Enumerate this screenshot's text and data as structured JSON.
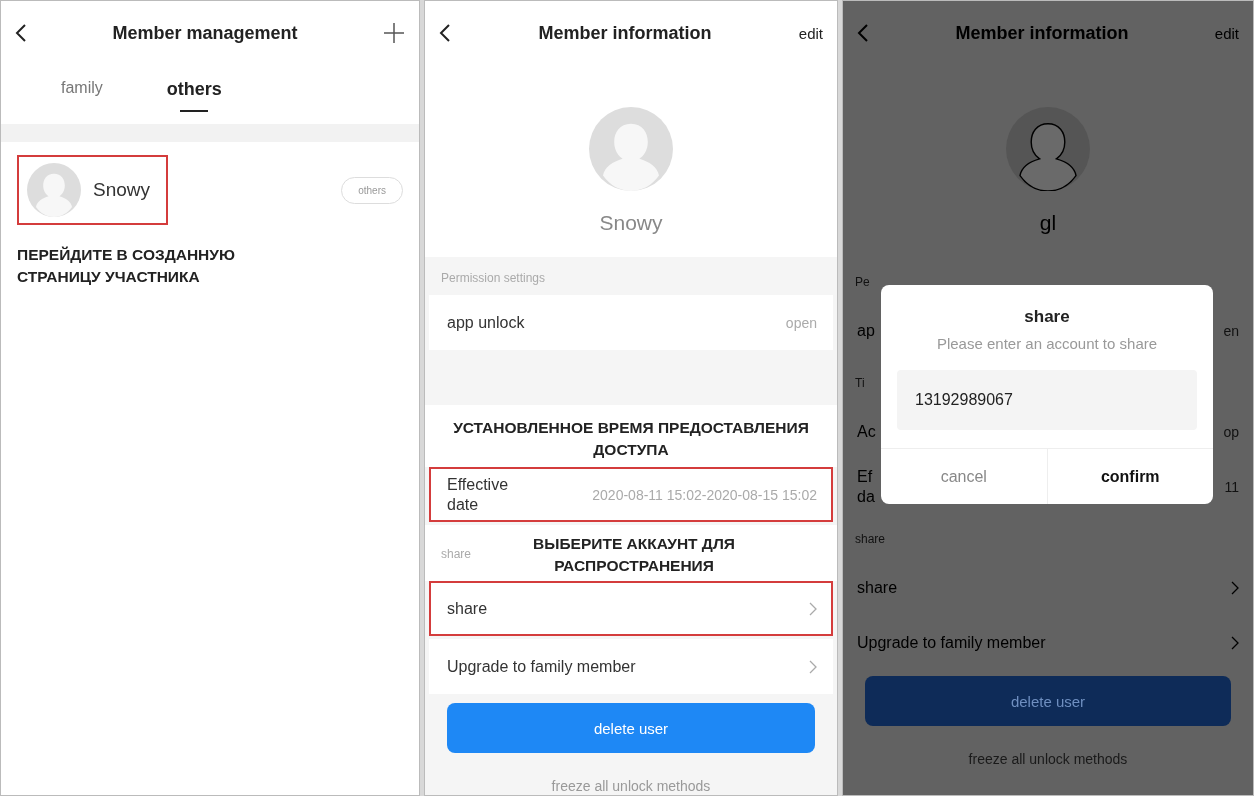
{
  "panels": [
    {
      "kind": "member_list",
      "title": "Member management",
      "dimmed": false,
      "tabs": [
        {
          "label": "family",
          "selected": false
        },
        {
          "label": "others",
          "selected": true
        }
      ],
      "members": [
        {
          "name": "Snowy",
          "tag": "others",
          "highlighted": true
        }
      ],
      "caption": "ПЕРЕЙДИТЕ В СОЗДАННУЮ СТРАНИЦУ УЧАСТНИКА"
    },
    {
      "kind": "member_info",
      "title": "Member information",
      "action": "edit",
      "name": "Snowy",
      "dimmed": false,
      "items": [
        {
          "kind": "label",
          "text": "Permission settings"
        },
        {
          "kind": "row",
          "label": "app unlock",
          "value": "open",
          "chevron": false,
          "highlighted": false
        },
        {
          "kind": "caption",
          "text": "УСТАНОВЛЕННОЕ ВРЕМЯ ПРЕДОСТАВЛЕНИЯ ДОСТУПА"
        },
        {
          "kind": "row",
          "label": "Effective date",
          "value": "2020-08-11 15:02-2020-08-15 15:02",
          "chevron": false,
          "highlighted": true
        },
        {
          "kind": "caption",
          "text": "ВЫБЕРИТЕ АККАУНТ ДЛЯ РАСПРОСТРАНЕНИЯ",
          "aside": "share"
        },
        {
          "kind": "row",
          "label": "share",
          "chevron": true,
          "highlighted": true
        },
        {
          "kind": "row",
          "label": "Upgrade to family member",
          "chevron": true,
          "highlighted": false
        },
        {
          "kind": "button",
          "label": "delete user"
        },
        {
          "kind": "link",
          "label": "freeze all unlock methods"
        }
      ]
    },
    {
      "kind": "member_info",
      "title": "Member information",
      "action": "edit",
      "name": "gl",
      "dimmed": true,
      "items": [
        {
          "kind": "label",
          "text": "Pe"
        },
        {
          "kind": "row",
          "label": "ap",
          "value": "en",
          "chevron": false,
          "highlighted": false
        },
        {
          "kind": "label",
          "text": "Ti"
        },
        {
          "kind": "row",
          "label": "Ac",
          "value": "op",
          "chevron": false,
          "highlighted": false
        },
        {
          "kind": "row",
          "label_lines": [
            "Ef",
            "da"
          ],
          "value": "11",
          "chevron": false,
          "highlighted": false
        },
        {
          "kind": "label",
          "text": "share"
        },
        {
          "kind": "row",
          "label": "share",
          "chevron": true,
          "highlighted": false
        },
        {
          "kind": "row",
          "label": "Upgrade to family member",
          "chevron": true,
          "highlighted": false
        },
        {
          "kind": "button",
          "label": "delete user"
        },
        {
          "kind": "link",
          "label": "freeze all unlock methods"
        }
      ],
      "dialog": {
        "title": "share",
        "message": "Please enter an account to share",
        "value": "13192989067",
        "buttons": [
          {
            "label": "cancel",
            "primary": false
          },
          {
            "label": "confirm",
            "primary": true
          }
        ]
      }
    }
  ]
}
